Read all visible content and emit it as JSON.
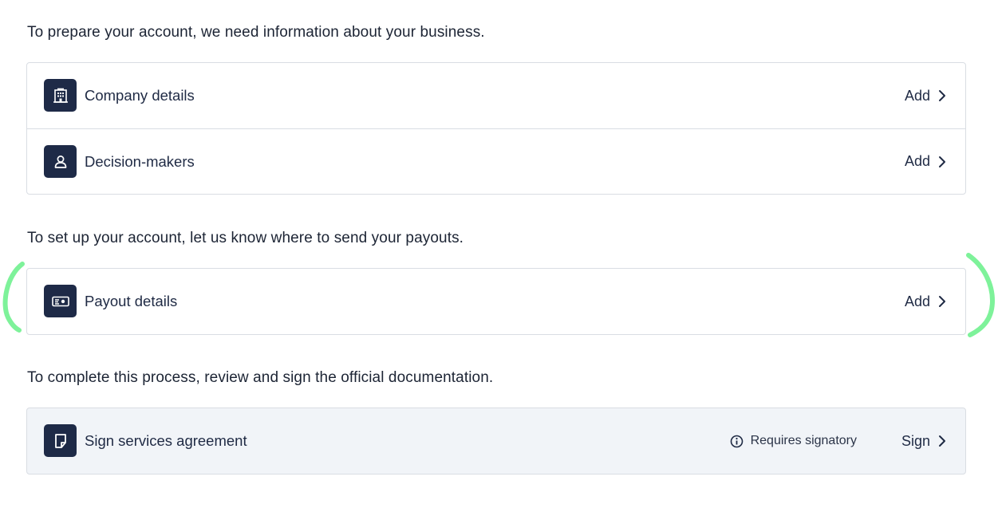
{
  "sections": [
    {
      "intro": "To prepare your account, we need information about your business.",
      "rows": [
        {
          "label": "Company details",
          "action": "Add",
          "icon": "building-icon"
        },
        {
          "label": "Decision-makers",
          "action": "Add",
          "icon": "person-icon"
        }
      ]
    },
    {
      "intro": "To set up your account, let us know where to send your payouts.",
      "rows": [
        {
          "label": "Payout details",
          "action": "Add",
          "icon": "banknote-icon"
        }
      ]
    },
    {
      "intro": "To complete this process, review and sign the official documentation.",
      "rows": [
        {
          "label": "Sign services agreement",
          "action": "Sign",
          "note": "Requires signatory",
          "note_icon": "info-icon",
          "icon": "document-icon"
        }
      ]
    }
  ],
  "colors": {
    "icon_tile": "#1e2a47",
    "text": "#1f2a44",
    "border": "#d9dde3",
    "muted_card": "#f1f4f8",
    "highlight_bracket": "#7ef29a"
  }
}
